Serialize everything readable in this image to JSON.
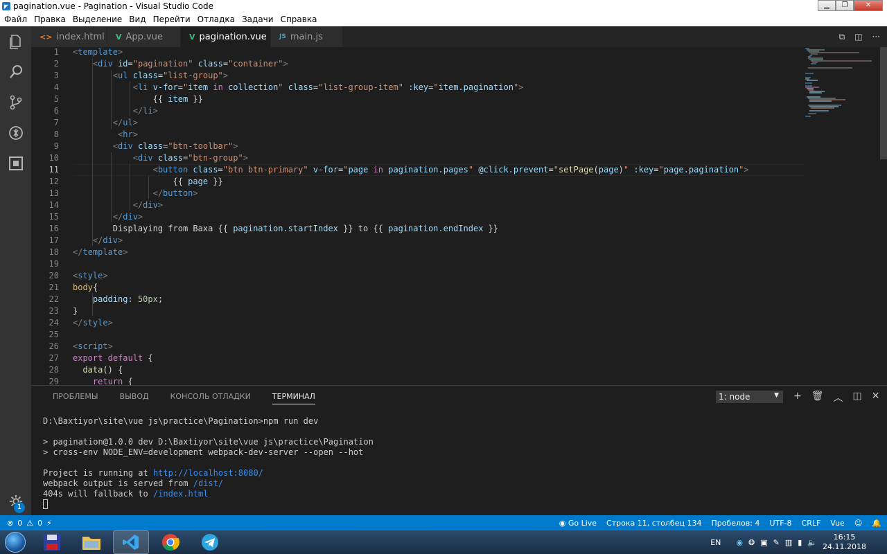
{
  "window": {
    "title": "pagination.vue - Pagination - Visual Studio Code"
  },
  "menu": [
    "Файл",
    "Правка",
    "Выделение",
    "Вид",
    "Перейти",
    "Отладка",
    "Задачи",
    "Справка"
  ],
  "tabs": [
    {
      "label": "index.html",
      "icon": "<>",
      "icon_color": "#e37933"
    },
    {
      "label": "App.vue",
      "icon": "V",
      "icon_color": "#41b883"
    },
    {
      "label": "pagination.vue",
      "icon": "V",
      "icon_color": "#41b883",
      "active": true
    },
    {
      "label": "main.js",
      "icon": "JS",
      "icon_color": "#519aba"
    }
  ],
  "editor": {
    "line_numbers": [
      "1",
      "2",
      "3",
      "4",
      "5",
      "6",
      "7",
      "8",
      "9",
      "10",
      "11",
      "12",
      "13",
      "14",
      "15",
      "16",
      "17",
      "18",
      "19",
      "20",
      "21",
      "22",
      "23",
      "24",
      "25",
      "26",
      "27",
      "28",
      "29"
    ],
    "current_line": "11"
  },
  "panel": {
    "tabs": [
      "ПРОБЛЕМЫ",
      "ВЫВОД",
      "КОНСОЛЬ ОТЛАДКИ",
      "ТЕРМИНАЛ"
    ],
    "active_tab": "ТЕРМИНАЛ",
    "terminal_select": "1: node",
    "terminal": {
      "prompt": "D:\\Baxtiyor\\site\\vue js\\practice\\Pagination>npm run dev",
      "line1": "> pagination@1.0.0 dev D:\\Baxtiyor\\site\\vue js\\practice\\Pagination",
      "line2": "> cross-env NODE_ENV=development webpack-dev-server --open --hot",
      "running_prefix": "Project is running at ",
      "running_url": "http://localhost:8080/",
      "output_prefix": "webpack output is served from ",
      "output_path": "/dist/",
      "fallback_prefix": "404s will fallback to ",
      "fallback_path": "/index.html"
    }
  },
  "status": {
    "errors": "0",
    "warnings": "0",
    "golive": "Go Live",
    "position": "Строка 11, столбец 134",
    "spaces": "Пробелов: 4",
    "encoding": "UTF-8",
    "eol": "CRLF",
    "language": "Vue"
  },
  "activity": {
    "settings_badge": "1"
  },
  "taskbar": {
    "lang": "EN",
    "time": "16:15",
    "date": "24.11.2018"
  },
  "colors": {
    "accent": "#007acc",
    "tag": "#569cd6",
    "attr": "#9cdcfe",
    "string": "#ce9178",
    "keyword": "#c586c0",
    "selector": "#d7ba7d",
    "number": "#b5cea8"
  }
}
